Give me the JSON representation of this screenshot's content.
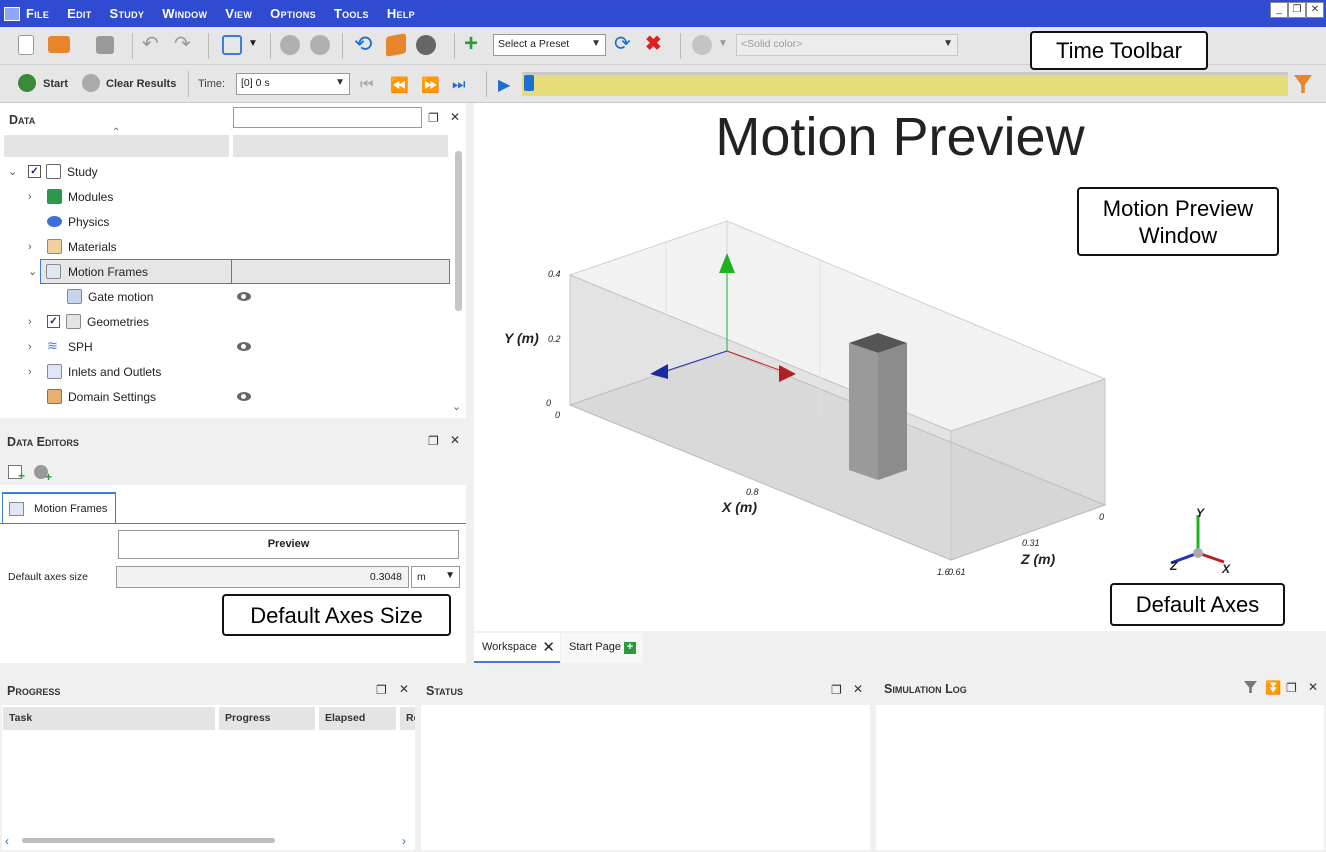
{
  "menu": [
    "File",
    "Edit",
    "Study",
    "Window",
    "View",
    "Options",
    "Tools",
    "Help"
  ],
  "window_controls": {
    "minimize": "_",
    "restore": "❐",
    "close": "✕"
  },
  "toolbar": {
    "preset_placeholder": "Select a Preset",
    "solid_color": "<Solid color>",
    "start_label": "Start",
    "clear_results_label": "Clear Results",
    "time_label": "Time:",
    "time_value": "[0] 0 s"
  },
  "callouts": {
    "time_toolbar": "Time Toolbar",
    "motion_preview_window": "Motion Preview Window",
    "default_axes_size": "Default Axes Size",
    "default_axes": "Default Axes"
  },
  "data_panel": {
    "title": "Data",
    "tree": [
      {
        "label": "Study",
        "level": 0,
        "expanded": true,
        "checked": true,
        "eye": false
      },
      {
        "label": "Modules",
        "level": 1,
        "collapsed": true,
        "eye": false
      },
      {
        "label": "Physics",
        "level": 1,
        "eye": false
      },
      {
        "label": "Materials",
        "level": 1,
        "collapsed": true,
        "eye": false
      },
      {
        "label": "Motion Frames",
        "level": 1,
        "expanded": true,
        "selected": true,
        "eye": false
      },
      {
        "label": "Gate motion",
        "level": 2,
        "eye": true
      },
      {
        "label": "Geometries",
        "level": 1,
        "collapsed": true,
        "checked": true,
        "eye": false
      },
      {
        "label": "SPH",
        "level": 1,
        "collapsed": true,
        "eye": true
      },
      {
        "label": "Inlets and Outlets",
        "level": 1,
        "collapsed": true,
        "eye": false
      },
      {
        "label": "Domain Settings",
        "level": 1,
        "eye": true
      }
    ]
  },
  "data_editors": {
    "title": "Data Editors",
    "tab_label": "Motion Frames",
    "preview_button": "Preview",
    "axes_size_label": "Default axes size",
    "axes_size_value": "0.3048",
    "axes_size_unit": "m"
  },
  "viewport": {
    "title": "Motion Preview",
    "y_axis_label": "Y (m)",
    "x_axis_label": "X (m)",
    "z_axis_label": "Z (m)",
    "y_ticks": [
      "0.4",
      "0.2",
      "0"
    ],
    "x_ticks": [
      "0",
      "0.8",
      "1.6"
    ],
    "z_ticks": [
      "0",
      "0.31",
      "0.61"
    ],
    "orient_labels": {
      "y": "Y",
      "z": "Z",
      "x": "X"
    }
  },
  "viewport_tabs": [
    {
      "label": "Workspace",
      "active": true
    },
    {
      "label": "Start Page",
      "active": false
    }
  ],
  "progress": {
    "title": "Progress",
    "columns": [
      "Task",
      "Progress",
      "Elapsed",
      "Re"
    ]
  },
  "status": {
    "title": "Status"
  },
  "simulation_log": {
    "title": "Simulation Log"
  },
  "colors": {
    "menubar": "#2f4bd2",
    "timeline": "#e7dc7a",
    "accent": "#1a6fd1"
  }
}
